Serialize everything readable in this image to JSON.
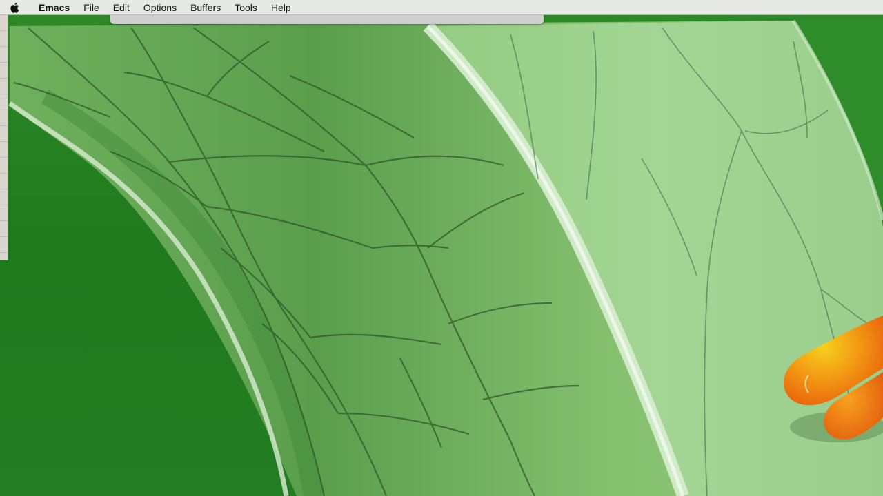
{
  "menubar": {
    "apple_icon": "apple-icon",
    "app_name": "Emacs",
    "items": [
      "File",
      "Edit",
      "Options",
      "Buffers",
      "Tools",
      "Help"
    ]
  },
  "colors": {
    "menubar_bg": "#ececec",
    "leaf_light": "#9fd08d",
    "leaf_dark": "#4e9540",
    "background_green": "#1f7a1e",
    "frog_toe": "#f07a12"
  }
}
